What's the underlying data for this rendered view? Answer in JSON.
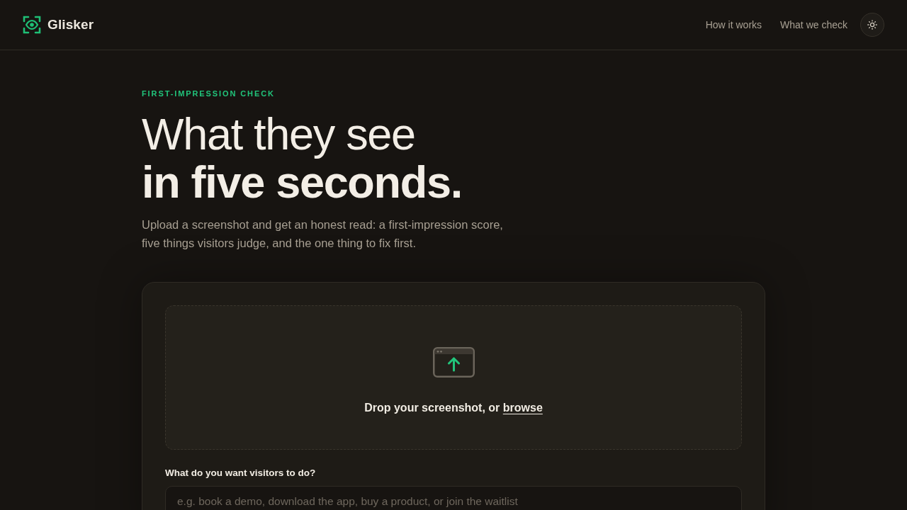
{
  "header": {
    "brand": "Glisker",
    "nav": [
      {
        "label": "How it works"
      },
      {
        "label": "What we check"
      }
    ]
  },
  "hero": {
    "eyebrow": "FIRST-IMPRESSION CHECK",
    "title_line_1": "What they see",
    "title_line_2": "in five seconds.",
    "description": "Upload a screenshot and get an honest read: a first-impression score, five things visitors judge, and the one thing to fix first."
  },
  "upload": {
    "dropzone": {
      "prompt": "Drop your screenshot, or",
      "link": "browse"
    },
    "goal_field": {
      "label": "What do you want visitors to do?",
      "placeholder": "e.g. book a demo, download the app, buy a product, or join the waitlist"
    }
  }
}
